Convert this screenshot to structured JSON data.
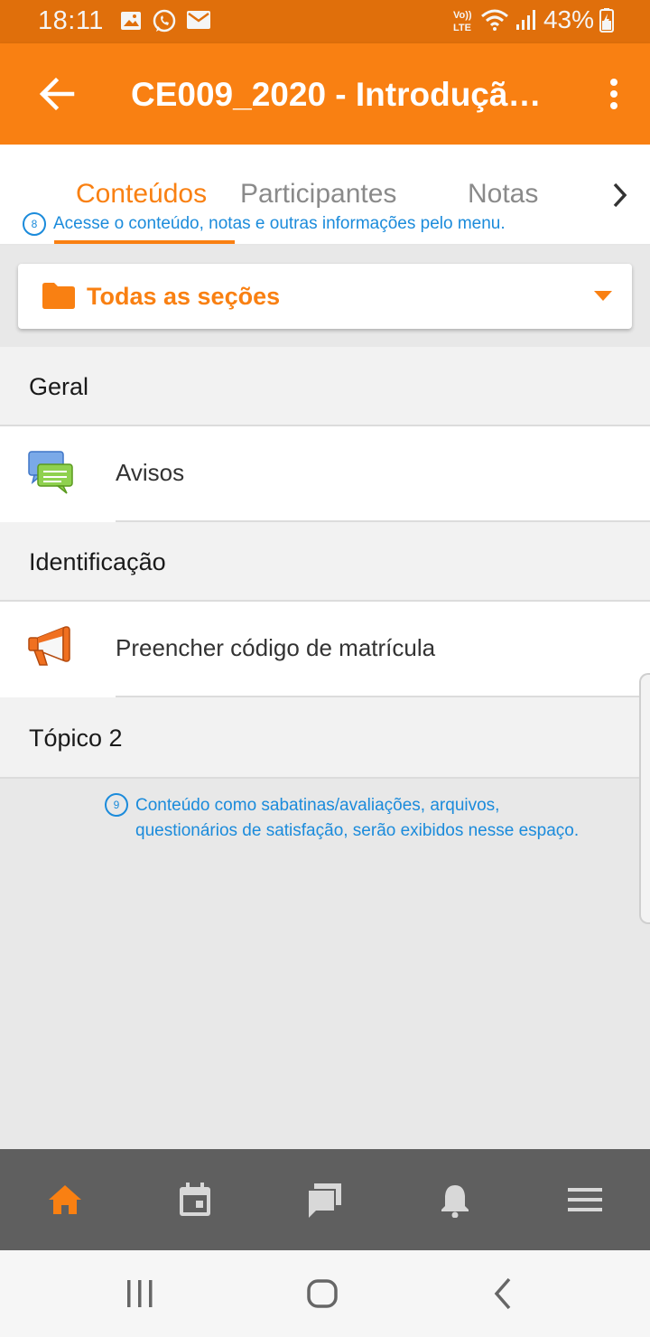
{
  "status_bar": {
    "time": "18:11",
    "battery": "43%",
    "left_icons": [
      "gallery-icon",
      "whatsapp-icon",
      "mail-icon"
    ],
    "right_icons": [
      "volte-icon",
      "wifi-icon",
      "signal-icon",
      "battery-icon"
    ]
  },
  "app_bar": {
    "title": "CE009_2020 - Introdução...",
    "back_icon": "arrow-left-icon",
    "menu_icon": "more-vert-icon",
    "color": "#f98012"
  },
  "tabs": {
    "items": [
      {
        "label": "Conteúdos",
        "active": true
      },
      {
        "label": "Participantes",
        "active": false
      },
      {
        "label": "Notas",
        "active": false
      }
    ],
    "next_icon": "chevron-right-icon"
  },
  "annotations": {
    "a8": {
      "number": "8",
      "text": "Acesse o conteúdo, notas e outras informações pelo menu."
    },
    "a9": {
      "number": "9",
      "line1": "Conteúdo como sabatinas/avaliações, arquivos,",
      "line2": "questionários de satisfação, serão exibidos nesse espaço."
    }
  },
  "section_selector": {
    "label": "Todas as seções",
    "icon": "folder-icon"
  },
  "sections": [
    {
      "title": "Geral",
      "modules": [
        {
          "label": "Avisos",
          "icon": "forum-icon"
        }
      ]
    },
    {
      "title": "Identificação",
      "modules": [
        {
          "label": "Preencher código de matrícula",
          "icon": "megaphone-icon"
        }
      ]
    },
    {
      "title": "Tópico 2",
      "modules": []
    }
  ],
  "bottom_nav": {
    "items": [
      "home-icon",
      "calendar-icon",
      "messages-icon",
      "notifications-icon",
      "menu-icon"
    ],
    "active": "home-icon"
  },
  "system_nav": {
    "items": [
      "recents-icon",
      "home-circle-icon",
      "back-chevron-icon"
    ]
  }
}
